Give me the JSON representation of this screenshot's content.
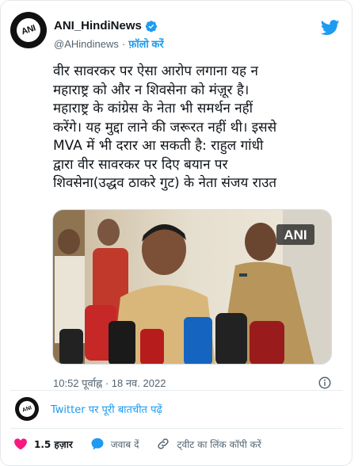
{
  "author": {
    "display_name": "ANI_HindiNews",
    "handle": "@AHindinews",
    "separator": "·",
    "follow_label": "फ़ॉलो करें",
    "avatar_text": "ANI"
  },
  "tweet": {
    "text": "वीर सावरकर पर ऐसा आरोप लगाना यह न\nमहाराष्ट्र को और न शिवसेना को मंज़ूर है।\nमहाराष्ट्र के कांग्रेस के नेता भी समर्थन नहीं\nकरेंगे। यह मुद्दा लाने की जरूरत नहीं थी। इससे\nMVA में भी दरार आ सकती है: राहुल गांधी\nद्वारा वीर सावरकर पर दिए बयान पर\nशिवसेना(उद्धव ठाकरे गुट) के नेता संजय राउत",
    "timestamp": "10:52 पूर्वाह्न · 18 नव. 2022",
    "media_watermark": "ANI"
  },
  "conversation": {
    "link_text": "Twitter पर पूरी बातचीत पढ़ें"
  },
  "actions": {
    "likes": "1.5 हज़ार",
    "reply": "जवाब दें",
    "copy_link": "ट्वीट का लिंक कॉपी करें"
  },
  "colors": {
    "accent": "#1d9bf0",
    "like": "#f91880",
    "muted": "#536471"
  },
  "icons": [
    "verified-badge-icon",
    "twitter-bird-icon",
    "info-icon",
    "heart-icon",
    "reply-icon",
    "link-icon"
  ]
}
